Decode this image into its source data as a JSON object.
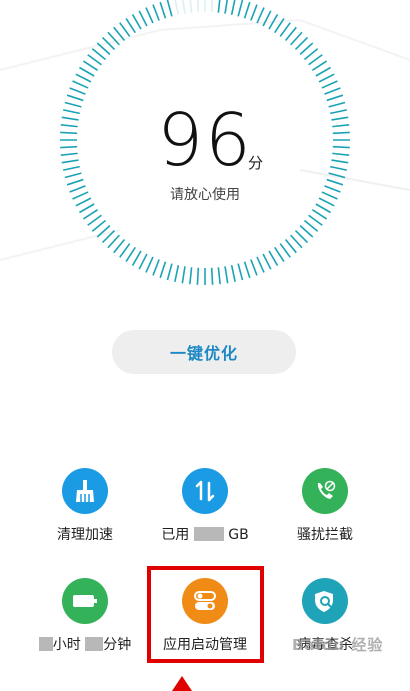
{
  "gauge": {
    "score": "96",
    "unit": "分",
    "status": "请放心使用"
  },
  "optimize_label": "一键优化",
  "tiles": [
    {
      "label": "清理加速",
      "icon": "broom-icon",
      "color": "#1b9be3"
    },
    {
      "label_prefix": "已用",
      "label_suffix": "GB",
      "icon": "data-transfer-icon",
      "color": "#1b9be3"
    },
    {
      "label": "骚扰拦截",
      "icon": "phone-block-icon",
      "color": "#34b25a"
    },
    {
      "label_hours": "小时",
      "label_minutes": "分钟",
      "icon": "battery-icon",
      "color": "#34b25a"
    },
    {
      "label": "应用启动管理",
      "icon": "toggle-switch-icon",
      "color": "#f08c16"
    },
    {
      "label": "病毒查杀",
      "icon": "shield-scan-icon",
      "color": "#1fa3b8"
    }
  ],
  "watermark": "Baidu 经验",
  "colors": {
    "accent_blue": "#1e88c7",
    "dial_ticks": "#1aa3b5",
    "highlight": "#e00000"
  }
}
